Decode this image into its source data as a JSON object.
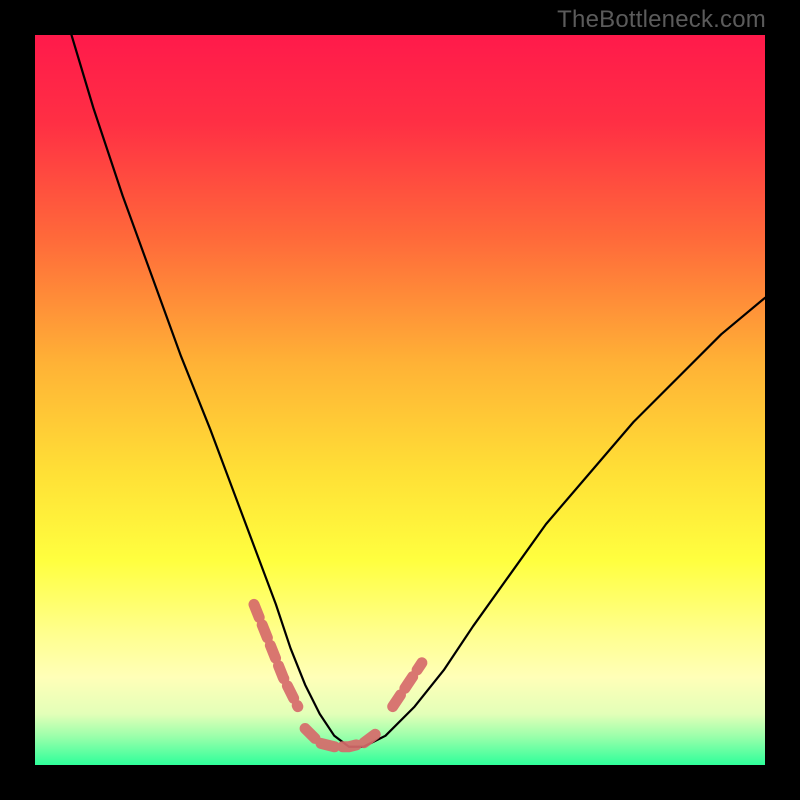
{
  "watermark": "TheBottleneck.com",
  "chart_data": {
    "type": "line",
    "title": "",
    "xlabel": "",
    "ylabel": "",
    "xlim": [
      0,
      100
    ],
    "ylim": [
      0,
      100
    ],
    "gradient_stops": [
      {
        "offset": 0,
        "color": "#ff1a4b"
      },
      {
        "offset": 12,
        "color": "#ff2f44"
      },
      {
        "offset": 28,
        "color": "#ff6a3a"
      },
      {
        "offset": 45,
        "color": "#ffb236"
      },
      {
        "offset": 60,
        "color": "#ffe036"
      },
      {
        "offset": 72,
        "color": "#ffff3f"
      },
      {
        "offset": 82,
        "color": "#ffff8e"
      },
      {
        "offset": 88,
        "color": "#ffffb8"
      },
      {
        "offset": 93,
        "color": "#e3ffb8"
      },
      {
        "offset": 96,
        "color": "#9dffab"
      },
      {
        "offset": 100,
        "color": "#2eff9a"
      }
    ],
    "series": [
      {
        "name": "bottleneck-curve",
        "color": "#000000",
        "width": 2.2,
        "x": [
          5,
          8,
          12,
          16,
          20,
          24,
          27,
          30,
          33,
          35,
          37,
          39,
          41,
          43,
          45,
          48,
          52,
          56,
          60,
          65,
          70,
          76,
          82,
          88,
          94,
          100
        ],
        "y": [
          100,
          90,
          78,
          67,
          56,
          46,
          38,
          30,
          22,
          16,
          11,
          7,
          4,
          2.5,
          2.5,
          4,
          8,
          13,
          19,
          26,
          33,
          40,
          47,
          53,
          59,
          64
        ]
      }
    ],
    "highlight_segments": [
      {
        "name": "left-shoulder",
        "color": "#d66a6a",
        "width": 11,
        "x": [
          30,
          32,
          34,
          36
        ],
        "y": [
          22,
          17,
          12,
          8
        ]
      },
      {
        "name": "valley-floor",
        "color": "#d66a6a",
        "width": 11,
        "x": [
          37,
          39,
          41,
          43,
          45,
          47
        ],
        "y": [
          5,
          3,
          2.5,
          2.5,
          3,
          4.5
        ]
      },
      {
        "name": "right-shoulder",
        "color": "#d66a6a",
        "width": 11,
        "x": [
          49,
          51,
          53
        ],
        "y": [
          8,
          11,
          14
        ]
      }
    ]
  }
}
